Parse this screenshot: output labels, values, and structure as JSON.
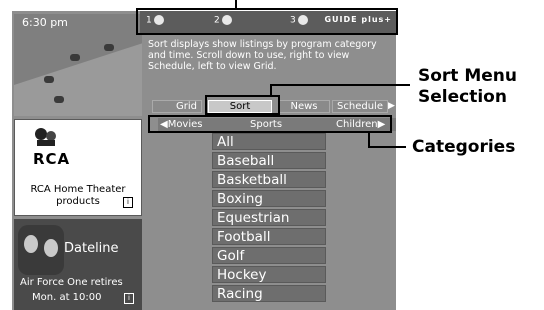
{
  "video": {
    "time": "6:30 pm"
  },
  "topbar": {
    "slots": [
      {
        "num": "1"
      },
      {
        "num": "2"
      },
      {
        "num": "3"
      }
    ],
    "brand": "GUIDE plus+"
  },
  "help_text": "Sort displays show listings by program category and time. Scroll down to use, right to view Schedule, left to view Grid.",
  "ad": {
    "line1": "RCA Home Theater",
    "line2": "products",
    "logo": "RCA",
    "info": "i"
  },
  "promo": {
    "title": "Dateline",
    "line1": "Air Force One retires",
    "line2": "Mon. at 10:00",
    "info": "i"
  },
  "tabs": [
    "Grid",
    "Sort",
    "News",
    "Schedule"
  ],
  "selected_tab": "Sort",
  "categories": {
    "left": "◀Movies",
    "center": "Sports",
    "right": "Children▶"
  },
  "list": [
    "All",
    "Baseball",
    "Basketball",
    "Boxing",
    "Equestrian",
    "Football",
    "Golf",
    "Hockey",
    "Racing"
  ],
  "callouts": {
    "sort_menu_line1": "Sort Menu",
    "sort_menu_line2": "Selection",
    "categories": "Categories"
  }
}
